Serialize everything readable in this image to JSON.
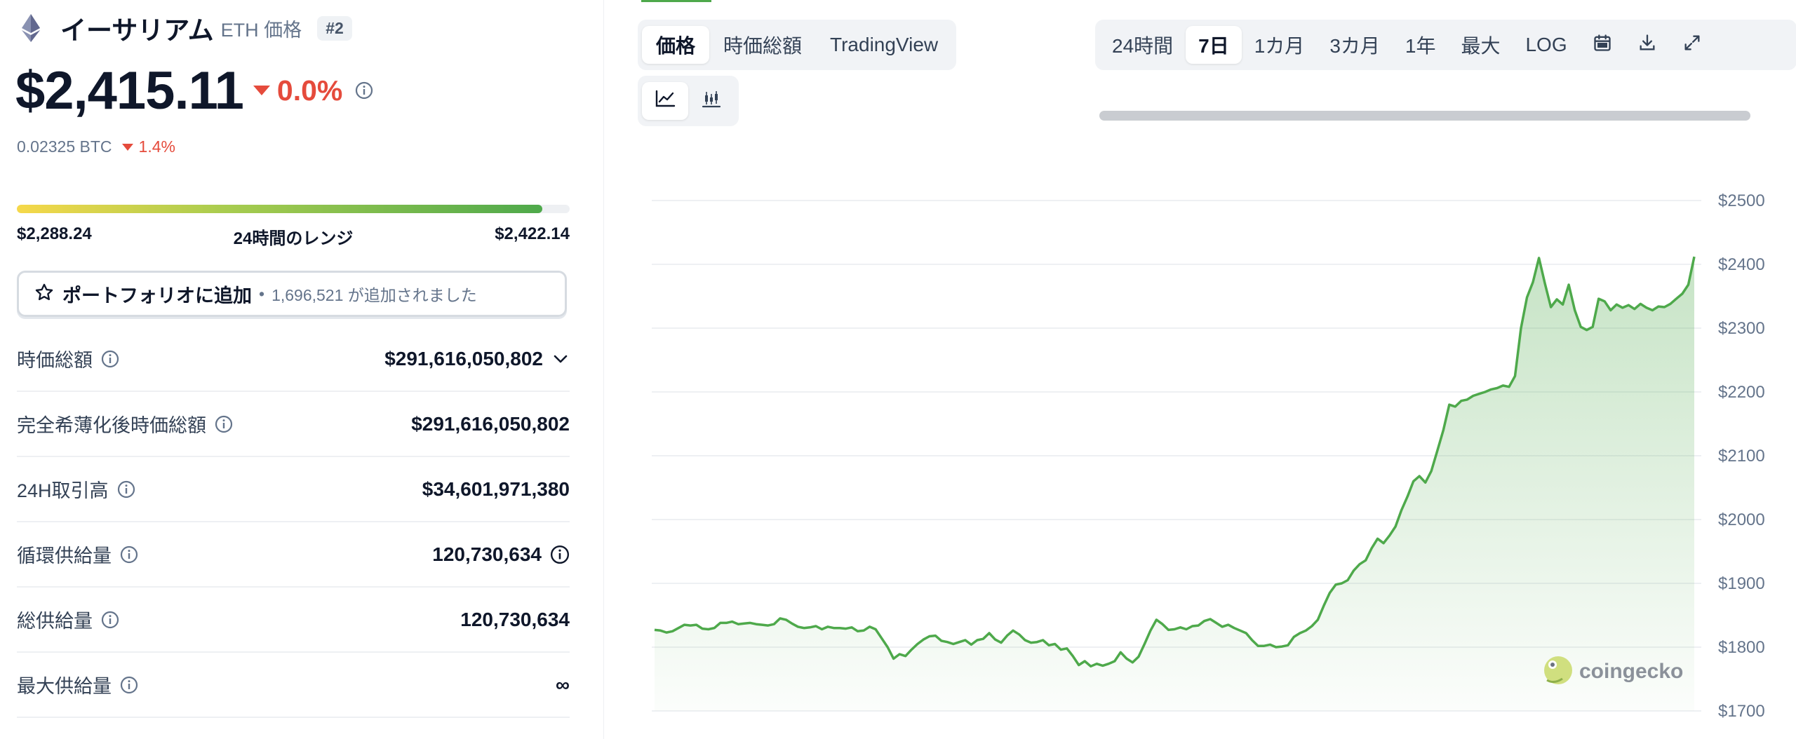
{
  "coin": {
    "name": "イーサリアム",
    "symbol_label": "ETH 価格",
    "rank": "#2",
    "price": "$2,415.11",
    "change_pct": "0.0%",
    "btc_price": "0.02325 BTC",
    "btc_change_pct": "1.4%"
  },
  "range": {
    "low": "$2,288.24",
    "label": "24時間のレンジ",
    "high": "$2,422.14",
    "position": 0.95
  },
  "portfolio": {
    "label": "ポートフォリオに追加",
    "separator": "•",
    "count_text": "1,696,521 が追加されました"
  },
  "stats": [
    {
      "label": "時価総額",
      "value": "$291,616,050,802",
      "trail": "chevron"
    },
    {
      "label": "完全希薄化後時価総額",
      "value": "$291,616,050,802",
      "trail": ""
    },
    {
      "label": "24H取引高",
      "value": "$34,601,971,380",
      "trail": ""
    },
    {
      "label": "循環供給量",
      "value": "120,730,634",
      "trail": "info"
    },
    {
      "label": "総供給量",
      "value": "120,730,634",
      "trail": ""
    },
    {
      "label": "最大供給量",
      "value": "∞",
      "trail": ""
    }
  ],
  "tabs": {
    "view": [
      "価格",
      "時価総額",
      "TradingView"
    ],
    "view_active": 0,
    "chart_types": [
      "line-chart-icon",
      "candlestick-icon"
    ],
    "ranges": [
      "24時間",
      "7日",
      "1カ月",
      "3カ月",
      "1年",
      "最大",
      "LOG"
    ],
    "range_active": 1,
    "range_icons": [
      "calendar-icon",
      "download-icon",
      "expand-icon"
    ]
  },
  "watermark": "coingecko",
  "colors": {
    "line": "#4ea94b",
    "negative": "#e54b3c",
    "accent": "#4ea94b"
  },
  "chart_data": {
    "type": "area",
    "title": "",
    "xlabel": "",
    "ylabel": "",
    "ylim": [
      1700,
      2500
    ],
    "yticks": [
      "$2500",
      "$2400",
      "$2300",
      "$2200",
      "$2100",
      "$2000",
      "$1900",
      "$1800",
      "$1700"
    ],
    "grid": true,
    "series": [
      {
        "name": "",
        "values": [
          1827,
          1826,
          1823,
          1825,
          1830,
          1835,
          1834,
          1835,
          1829,
          1828,
          1830,
          1838,
          1838,
          1840,
          1836,
          1837,
          1838,
          1836,
          1835,
          1834,
          1836,
          1845,
          1843,
          1837,
          1832,
          1830,
          1831,
          1833,
          1828,
          1832,
          1830,
          1830,
          1829,
          1831,
          1825,
          1826,
          1832,
          1828,
          1814,
          1800,
          1782,
          1789,
          1786,
          1796,
          1805,
          1812,
          1817,
          1818,
          1810,
          1808,
          1805,
          1808,
          1811,
          1804,
          1811,
          1813,
          1822,
          1812,
          1807,
          1818,
          1826,
          1820,
          1811,
          1807,
          1808,
          1811,
          1803,
          1805,
          1796,
          1798,
          1786,
          1772,
          1778,
          1770,
          1774,
          1771,
          1774,
          1778,
          1792,
          1782,
          1776,
          1785,
          1805,
          1826,
          1843,
          1836,
          1827,
          1828,
          1831,
          1828,
          1833,
          1834,
          1841,
          1844,
          1838,
          1832,
          1835,
          1830,
          1826,
          1822,
          1811,
          1802,
          1802,
          1804,
          1800,
          1801,
          1803,
          1816,
          1822,
          1826,
          1833,
          1843,
          1865,
          1885,
          1898,
          1900,
          1905,
          1920,
          1930,
          1936,
          1955,
          1970,
          1963,
          1975,
          1989,
          2015,
          2036,
          2060,
          2068,
          2058,
          2076,
          2108,
          2140,
          2180,
          2177,
          2186,
          2188,
          2194,
          2197,
          2200,
          2204,
          2206,
          2210,
          2208,
          2225,
          2300,
          2348,
          2372,
          2410,
          2370,
          2333,
          2345,
          2337,
          2368,
          2328,
          2302,
          2297,
          2302,
          2346,
          2342,
          2328,
          2337,
          2332,
          2336,
          2330,
          2338,
          2332,
          2328,
          2334,
          2333,
          2338,
          2346,
          2354,
          2368,
          2412
        ]
      }
    ]
  }
}
